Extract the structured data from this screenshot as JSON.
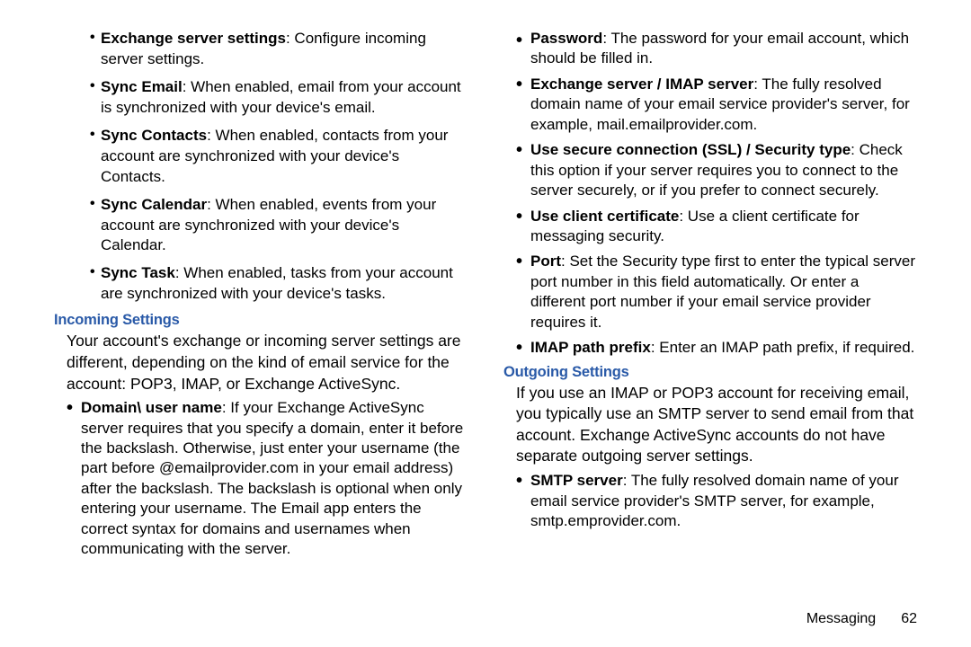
{
  "left_sub_bullets": [
    {
      "bold": "Exchange server settings",
      "rest": ": Configure incoming server settings."
    },
    {
      "bold": "Sync Email",
      "rest": ": When enabled, email from your account is synchronized with your device's email."
    },
    {
      "bold": "Sync Contacts",
      "rest": ": When enabled, contacts from your account are synchronized with your device's Contacts."
    },
    {
      "bold": "Sync Calendar",
      "rest": ": When enabled, events from your account are synchronized with your device's Calendar."
    },
    {
      "bold": "Sync Task",
      "rest": ": When enabled, tasks from your account are synchronized with your device's tasks."
    }
  ],
  "incoming": {
    "heading": "Incoming Settings",
    "intro": "Your account's exchange or incoming server settings are different, depending on the kind of email service for the account: POP3, IMAP, or Exchange ActiveSync.",
    "items": [
      {
        "bold": "Domain\\ user name",
        "rest": ": If your Exchange ActiveSync server requires that you specify a domain, enter it before the backslash. Otherwise, just enter your username (the part before @emailprovider.com in your email address) after the backslash. The backslash is optional when only entering your username. The Email app enters the correct syntax for domains and usernames when communicating with the server."
      },
      {
        "bold": "Password",
        "rest": ": The password for your email account, which should be filled in."
      },
      {
        "bold": "Exchange server / IMAP server",
        "rest": ": The fully resolved domain name of your email service provider's server, for example, mail.emailprovider.com."
      },
      {
        "bold": "Use secure connection (SSL) / Security type",
        "rest": ": Check this option if your server requires you to connect to the server securely, or if you prefer to connect securely."
      },
      {
        "bold": "Use client certificate",
        "rest": ": Use a client certificate for messaging security."
      },
      {
        "bold": "Port",
        "rest": ": Set the Security type first to enter the typical server port number in this field automatically. Or enter a different port number if your email service provider requires it."
      },
      {
        "bold": "IMAP path prefix",
        "rest": ": Enter an IMAP path prefix, if required."
      }
    ]
  },
  "outgoing": {
    "heading": "Outgoing Settings",
    "intro": "If you use an IMAP or POP3 account for receiving email, you typically use an SMTP server to send email from that account. Exchange ActiveSync accounts do not have separate outgoing server settings.",
    "items": [
      {
        "bold": "SMTP server",
        "rest": ": The fully resolved domain name of your email service provider's SMTP server, for example, smtp.emprovider.com."
      }
    ]
  },
  "footer": {
    "section": "Messaging",
    "page": "62"
  }
}
